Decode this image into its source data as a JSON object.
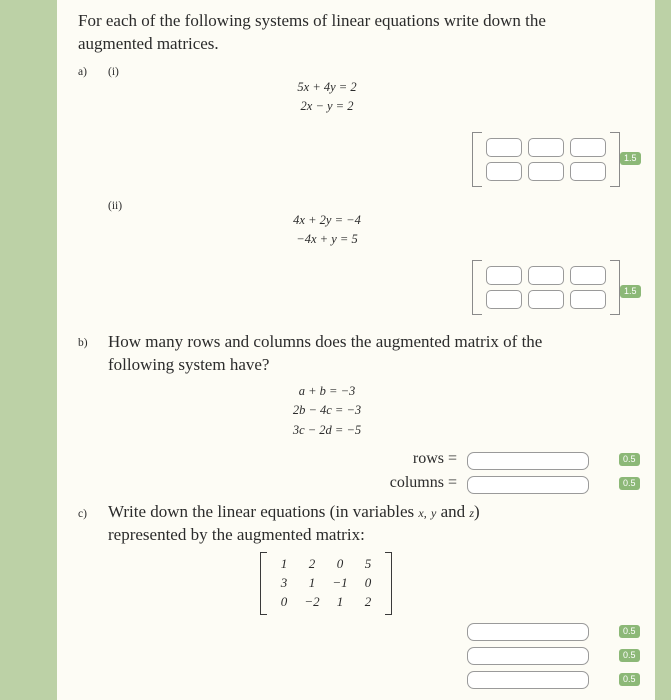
{
  "colors": {
    "band": "#bcd1a6",
    "page": "#fdfcf5",
    "badge": "#8cb877",
    "text": "#2b2b2b",
    "input_border": "#9a9a9a"
  },
  "intro": {
    "text": "For each of the following systems of linear equations write down the augmented matrices."
  },
  "parts": {
    "a": {
      "label": "a)",
      "sub_i": {
        "label": "(i)",
        "equations": [
          "5x + 4y = 2",
          "2x − y = 2"
        ],
        "matrix_rows": 2,
        "matrix_cols": 3,
        "cells": [
          [
            "",
            "",
            ""
          ],
          [
            "",
            "",
            ""
          ]
        ],
        "mark": "1.5"
      },
      "sub_ii": {
        "label": "(ii)",
        "equations": [
          "4x + 2y = −4",
          "−4x + y = 5"
        ],
        "matrix_rows": 2,
        "matrix_cols": 3,
        "cells": [
          [
            "",
            "",
            ""
          ],
          [
            "",
            "",
            ""
          ]
        ],
        "mark": "1.5"
      }
    },
    "b": {
      "label": "b)",
      "text": "How many rows and columns does the augmented matrix of the following system have?",
      "equations": [
        "a + b = −3",
        "2b − 4c = −3",
        "3c − 2d = −5"
      ],
      "fields": [
        {
          "label": "rows =",
          "value": "",
          "mark": "0.5"
        },
        {
          "label": "columns =",
          "value": "",
          "mark": "0.5"
        }
      ]
    },
    "c": {
      "label": "c)",
      "text_before": "Write down the linear equations (in variables",
      "var1": "x,",
      "var2": "y",
      "text_mid": "and",
      "var3": "z",
      "text_after": ")",
      "text_line2": "represented by the augmented matrix:",
      "matrix": [
        [
          "1",
          "2",
          "0",
          "5"
        ],
        [
          "3",
          "1",
          "−1",
          "0"
        ],
        [
          "0",
          "−2",
          "1",
          "2"
        ]
      ],
      "answers": [
        {
          "value": "",
          "mark": "0.5"
        },
        {
          "value": "",
          "mark": "0.5"
        },
        {
          "value": "",
          "mark": "0.5"
        }
      ]
    }
  }
}
